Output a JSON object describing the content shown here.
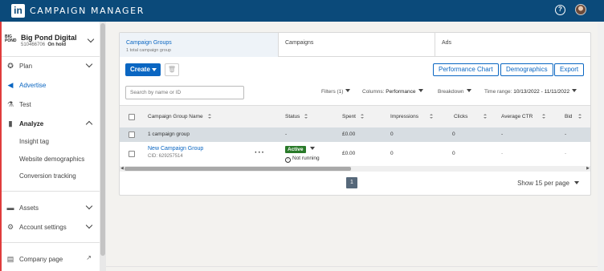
{
  "app": {
    "logo": "in",
    "title": "CAMPAIGN MANAGER"
  },
  "topbar": {
    "help_icon": "help-icon",
    "avatar": "avatar"
  },
  "account": {
    "logo_text": "BIG POND",
    "name": "Big Pond Digital",
    "id": "510466706",
    "status": "On hold"
  },
  "sidebar": {
    "plan": "Plan",
    "advertise": "Advertise",
    "test": "Test",
    "analyze": "Analyze",
    "analyze_items": [
      "Insight tag",
      "Website demographics",
      "Conversion tracking"
    ],
    "assets": "Assets",
    "account_settings": "Account settings",
    "company_page": "Company page"
  },
  "tabs": {
    "campaign_groups": "Campaign Groups",
    "campaign_groups_sub": "1 total campaign group",
    "campaigns": "Campaigns",
    "ads": "Ads"
  },
  "toolbar": {
    "create": "Create",
    "performance_chart": "Performance Chart",
    "demographics": "Demographics",
    "export": "Export"
  },
  "search": {
    "placeholder": "Search by name or ID"
  },
  "filters": {
    "filters_label": "Filters (1)",
    "columns_label": "Columns:",
    "columns_value": "Performance",
    "breakdown_label": "Breakdown",
    "time_range_label": "Time range:",
    "time_range_value": "10/13/2022 - 11/11/2022"
  },
  "table": {
    "headers": [
      "Campaign Group Name",
      "Status",
      "Spent",
      "Impressions",
      "Clicks",
      "Average CTR",
      "Bid"
    ],
    "total_row": {
      "name": "1 campaign group",
      "status": "-",
      "spent": "£0.00",
      "impressions": "0",
      "clicks": "0",
      "ctr": "-",
      "bid": "-"
    },
    "rows": [
      {
        "name": "New Campaign Group",
        "cid": "CID: 629257514",
        "status": "Active",
        "substatus": "Not running",
        "spent": "£0.00",
        "impressions": "0",
        "clicks": "0",
        "ctr": "-",
        "bid": "-"
      }
    ]
  },
  "pagination": {
    "page": "1",
    "per_page": "Show 15 per page"
  },
  "colors": {
    "topbar": "#0b4a7a",
    "primary": "#0a66c2",
    "active_badge": "#2a7a2a",
    "sidebar_accent": "#e03c3c"
  }
}
